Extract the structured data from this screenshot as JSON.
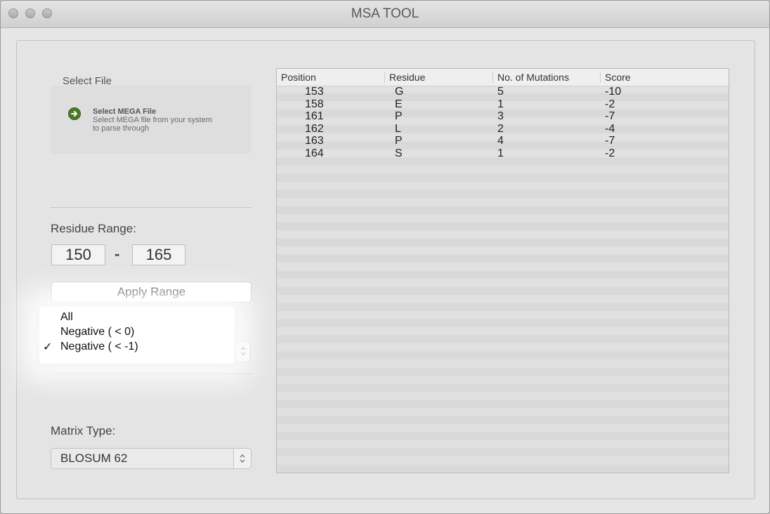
{
  "window": {
    "title": "MSA TOOL"
  },
  "file_panel": {
    "heading": "Select File",
    "icon": "arrow-right-circle-icon",
    "item_title": "Select MEGA File",
    "item_desc": "Select MEGA file from your system to parse through"
  },
  "residue_range": {
    "label": "Residue Range:",
    "from": "150",
    "to": "165",
    "dash": "-",
    "apply_label": "Apply Range"
  },
  "score_filter_menu": {
    "options": [
      "All",
      "Negative ( < 0)",
      "Negative ( < -1)"
    ],
    "selected_index": 2,
    "checkmark": "✓"
  },
  "matrix": {
    "label": "Matrix Type:",
    "value": "BLOSUM 62"
  },
  "table": {
    "columns": [
      "Position",
      "Residue",
      "No. of Mutations",
      "Score"
    ],
    "rows": [
      [
        "153",
        "G",
        "5",
        "-10"
      ],
      [
        "158",
        "E",
        "1",
        "-2"
      ],
      [
        "161",
        "P",
        "3",
        "-7"
      ],
      [
        "162",
        "L",
        "2",
        "-4"
      ],
      [
        "163",
        "P",
        "4",
        "-7"
      ],
      [
        "164",
        "S",
        "1",
        "-2"
      ]
    ]
  },
  "colors": {
    "icon_green": "#4b7a27",
    "table_stripe_light": "#e1e1e1",
    "table_stripe_dark": "#d9d9d9"
  }
}
